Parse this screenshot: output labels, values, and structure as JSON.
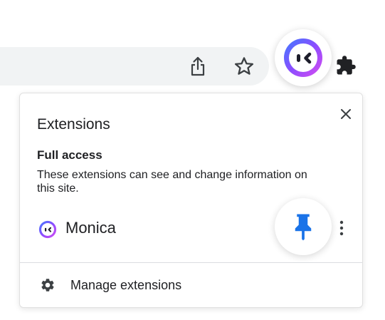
{
  "toolbar": {
    "share_icon": "share-icon",
    "bookmark_icon": "star-icon",
    "monica_icon": "monica-logo-icon",
    "extensions_icon": "puzzle-icon"
  },
  "panel": {
    "title": "Extensions",
    "close_icon": "close-icon",
    "section_title": "Full access",
    "section_description": "These extensions can see and change information on this site.",
    "extension": {
      "name": "Monica",
      "pin_icon": "pin-icon",
      "more_icon": "more-vert-icon",
      "pin_color": "#1a73e8"
    },
    "manage_label": "Manage extensions",
    "manage_icon": "gear-icon"
  }
}
